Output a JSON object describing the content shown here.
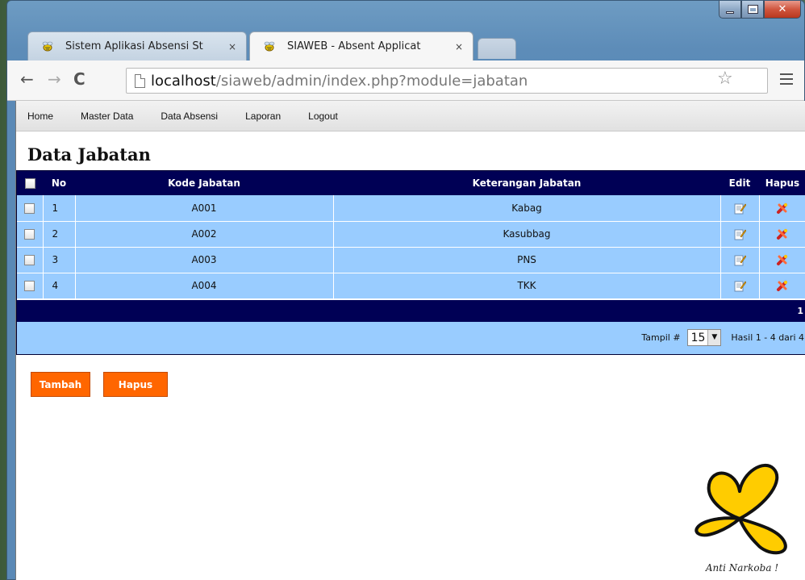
{
  "browser": {
    "tabs": [
      {
        "title": "Sistem Aplikasi Absensi St",
        "close": "×"
      },
      {
        "title": "SIAWEB - Absent Applicat",
        "close": "×"
      }
    ],
    "url_host": "localhost",
    "url_path": "/siaweb/admin/index.php?module=jabatan"
  },
  "menu": {
    "items": [
      "Home",
      "Master Data",
      "Data Absensi",
      "Laporan",
      "Logout"
    ]
  },
  "page": {
    "title": "Data Jabatan"
  },
  "table": {
    "headers": {
      "no": "No",
      "kode": "Kode Jabatan",
      "keterangan": "Keterangan Jabatan",
      "edit": "Edit",
      "hapus": "Hapus"
    },
    "rows": [
      {
        "no": "1",
        "kode": "A001",
        "keterangan": "Kabag"
      },
      {
        "no": "2",
        "kode": "A002",
        "keterangan": "Kasubbag"
      },
      {
        "no": "3",
        "kode": "A003",
        "keterangan": "PNS"
      },
      {
        "no": "4",
        "kode": "A004",
        "keterangan": "TKK"
      }
    ],
    "pager": "1",
    "footer": {
      "tampil_label": "Tampil #",
      "tampil_value": "15",
      "result_text": "Hasil 1 - 4 dari 4"
    }
  },
  "buttons": {
    "tambah": "Tambah",
    "hapus": "Hapus"
  },
  "logo_caption": "Anti Narkoba !",
  "colors": {
    "header_bg": "#000055",
    "row_bg": "#99ccff",
    "button_bg": "#ff6600"
  }
}
